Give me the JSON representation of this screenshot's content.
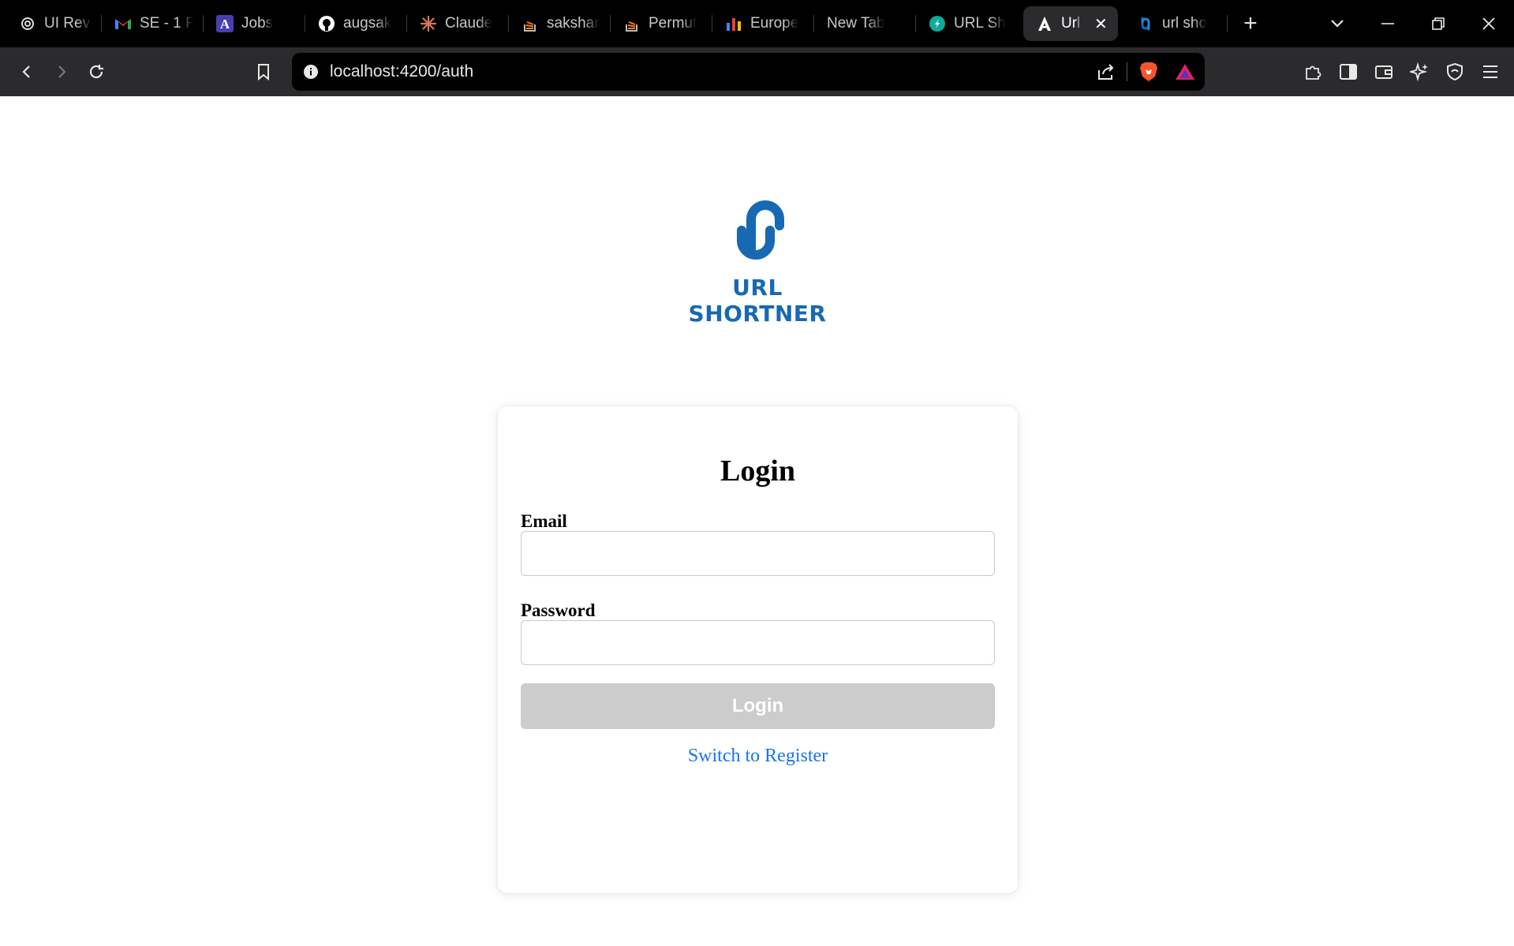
{
  "browser": {
    "tabs": [
      {
        "label": "UI Reva",
        "icon": "openai-icon"
      },
      {
        "label": "SE - 1 F",
        "icon": "gmail-icon"
      },
      {
        "label": "Jobs",
        "icon": "a-logo-icon"
      },
      {
        "label": "augsak",
        "icon": "github-icon"
      },
      {
        "label": "Claude",
        "icon": "claude-icon"
      },
      {
        "label": "sakshar",
        "icon": "stackoverflow-icon"
      },
      {
        "label": "Permut",
        "icon": "stackoverflow-icon"
      },
      {
        "label": "Europe",
        "icon": "bar-chart-icon"
      },
      {
        "label": "New Tab",
        "icon": ""
      },
      {
        "label": "URL Sh",
        "icon": "teal-logo-icon"
      },
      {
        "label": "Url",
        "icon": "angular-icon",
        "active": true
      },
      {
        "label": "url sho",
        "icon": "link-logo-icon"
      }
    ],
    "new_tab_symbol": "+",
    "url": "localhost:4200/auth",
    "colors": {
      "tabstrip": "#000000",
      "toolbar": "#2b2b2e",
      "active_tab": "#2b2b2e"
    }
  },
  "page": {
    "logo": {
      "text": "URL SHORTNER",
      "color": "#1769b4"
    },
    "login_card": {
      "title": "Login",
      "email_label": "Email",
      "email_value": "",
      "password_label": "Password",
      "password_value": "",
      "submit_label": "Login",
      "submit_color": "#cccccc",
      "switch_link": "Switch to Register",
      "link_color": "#1a73e8"
    }
  }
}
